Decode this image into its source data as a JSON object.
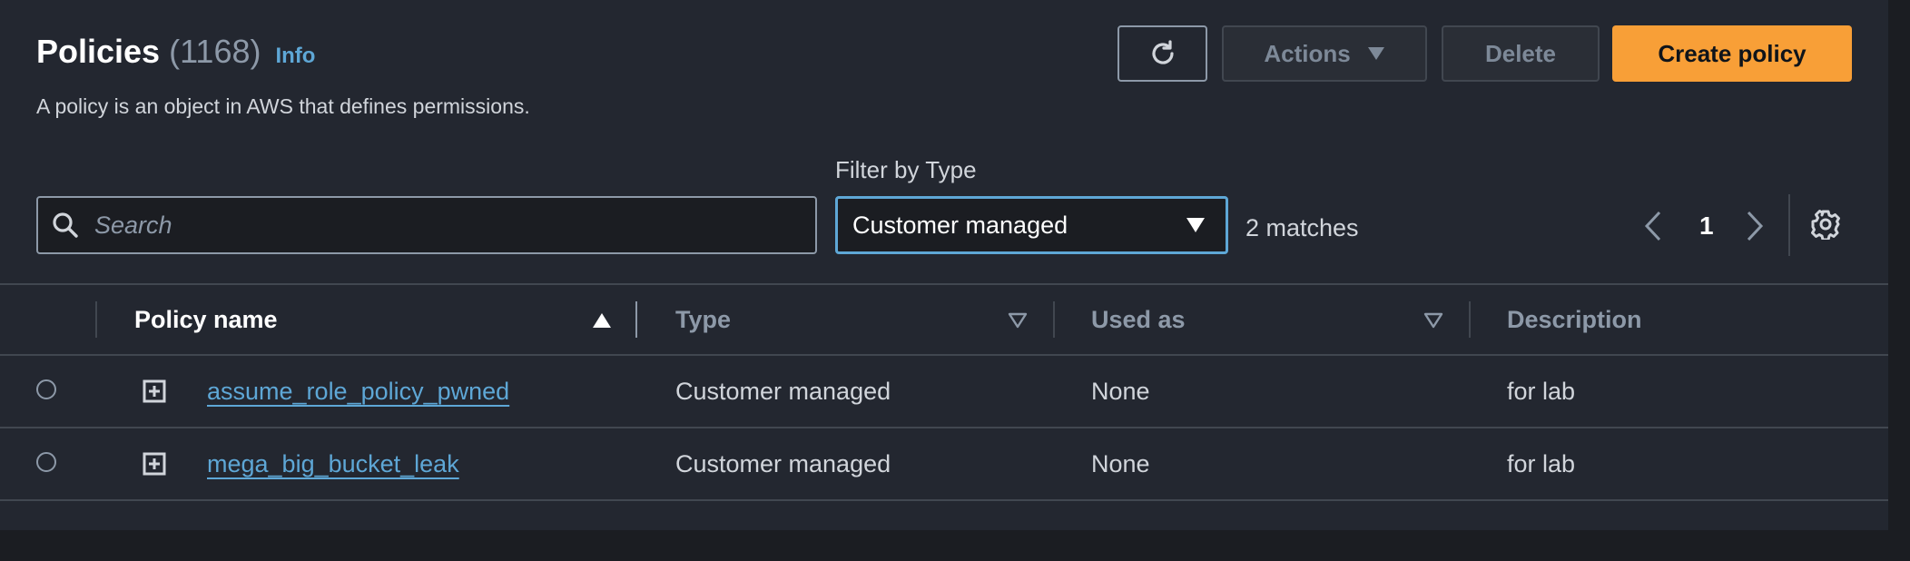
{
  "header": {
    "title": "Policies",
    "count": "(1168)",
    "info_link": "Info",
    "subtitle": "A policy is an object in AWS that defines permissions."
  },
  "toolbar": {
    "refresh_icon": "refresh-icon",
    "actions_label": "Actions",
    "delete_label": "Delete",
    "create_label": "Create policy"
  },
  "search": {
    "placeholder": "Search",
    "value": ""
  },
  "filter": {
    "label": "Filter by Type",
    "selected": "Customer managed"
  },
  "matches": "2 matches",
  "pagination": {
    "current_page": "1"
  },
  "table": {
    "columns": [
      "Policy name",
      "Type",
      "Used as",
      "Description"
    ],
    "rows": [
      {
        "name": "assume_role_policy_pwned",
        "type": "Customer managed",
        "used_as": "None",
        "description": "for lab"
      },
      {
        "name": "mega_big_bucket_leak",
        "type": "Customer managed",
        "used_as": "None",
        "description": "for lab"
      }
    ]
  },
  "colors": {
    "background": "#232730",
    "accent_orange": "#f89f37",
    "link_blue": "#5ea7d6"
  }
}
